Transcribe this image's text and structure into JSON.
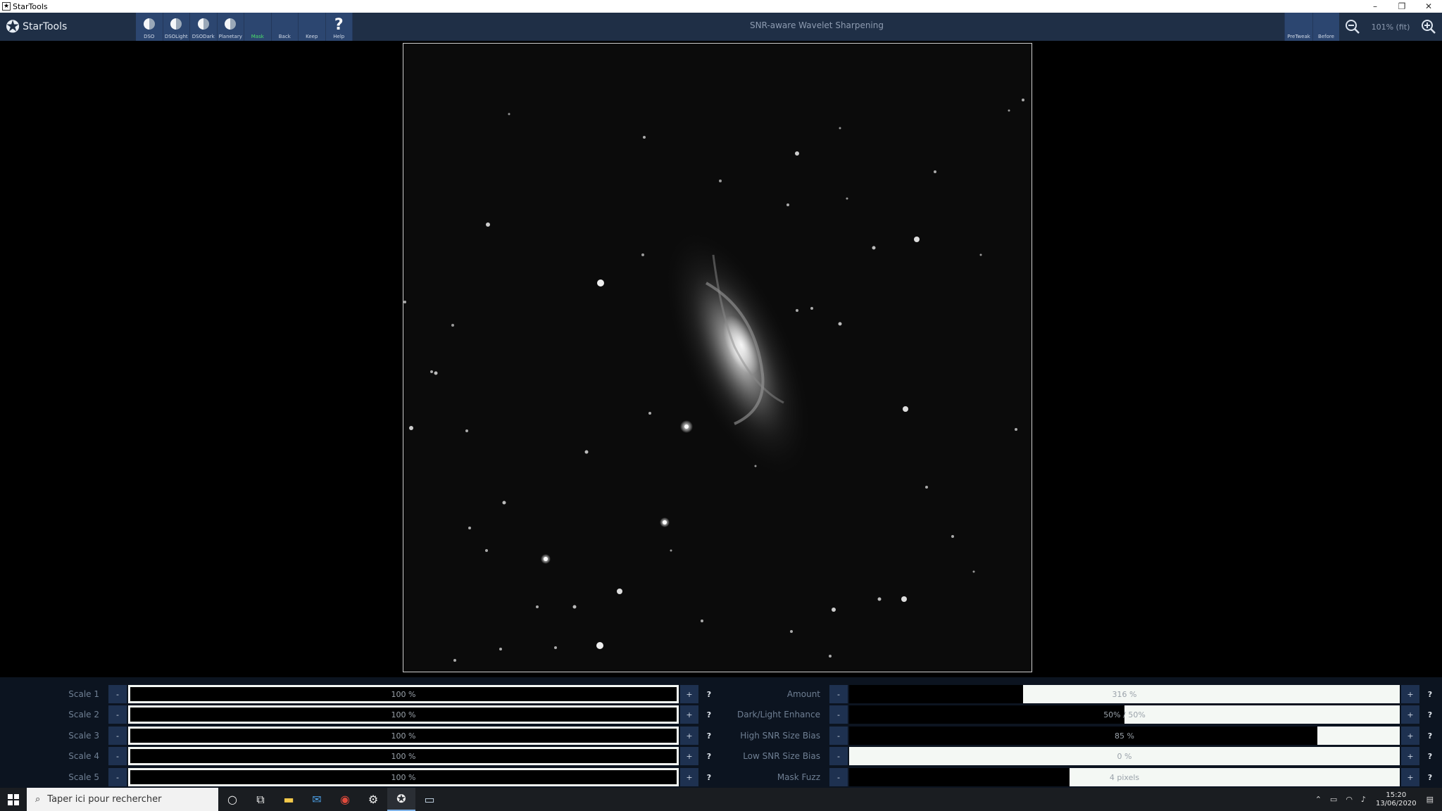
{
  "window": {
    "title": "StarTools",
    "controls": [
      "–",
      "❐",
      "✕"
    ]
  },
  "toolbar": {
    "logo_text": "StarTools",
    "buttons": [
      {
        "label": "DSO"
      },
      {
        "label": "DSOLight"
      },
      {
        "label": "DSODark"
      },
      {
        "label": "Planetary"
      },
      {
        "label": "Mask"
      },
      {
        "label": "Back"
      },
      {
        "label": "Keep"
      },
      {
        "label": "Help"
      }
    ],
    "tool_title": "SNR-aware Wavelet Sharpening",
    "right_buttons": [
      {
        "label": "PreTweak"
      },
      {
        "label": "Before"
      }
    ],
    "zoom_level": "101% (fit)"
  },
  "params_left": [
    {
      "label": "Scale 1",
      "value": "100 %",
      "fill": 1.0
    },
    {
      "label": "Scale 2",
      "value": "100 %",
      "fill": 1.0
    },
    {
      "label": "Scale 3",
      "value": "100 %",
      "fill": 1.0
    },
    {
      "label": "Scale 4",
      "value": "100 %",
      "fill": 1.0
    },
    {
      "label": "Scale 5",
      "value": "100 %",
      "fill": 1.0
    }
  ],
  "params_right": [
    {
      "label": "Amount",
      "value": "316 %",
      "fill": 0.316
    },
    {
      "label": "Dark/Light Enhance",
      "value": "50% / 50%",
      "fill": 0.5
    },
    {
      "label": "High SNR Size Bias",
      "value": "85 %",
      "fill": 0.85
    },
    {
      "label": "Low SNR Size Bias",
      "value": "0 %",
      "fill": 0.0
    },
    {
      "label": "Mask Fuzz",
      "value": "4 pixels",
      "fill": 0.4
    }
  ],
  "controls": {
    "minus": "-",
    "plus": "+",
    "help": "?"
  },
  "taskbar": {
    "search_placeholder": "Taper ici pour rechercher",
    "time": "15:20",
    "date": "13/06/2020"
  },
  "colors": {
    "toolbar_bg": "#1f2f46",
    "button_bg": "#2c4670",
    "active_label": "#4be06a",
    "panel_bg": "#0c1420"
  }
}
